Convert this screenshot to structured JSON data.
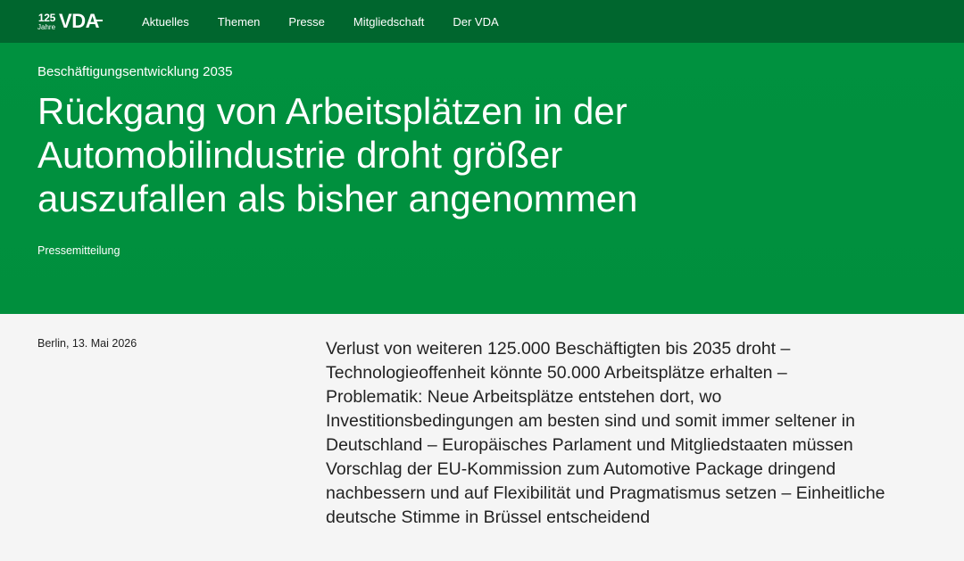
{
  "header": {
    "logo": {
      "anniversary_number": "125",
      "anniversary_word": "Jahre",
      "brand": "VDA"
    },
    "nav": [
      {
        "label": "Aktuelles"
      },
      {
        "label": "Themen"
      },
      {
        "label": "Presse"
      },
      {
        "label": "Mitgliedschaft"
      },
      {
        "label": "Der VDA"
      }
    ]
  },
  "hero": {
    "kicker": "Beschäftigungsentwicklung 2035",
    "headline": "Rückgang von Arbeitsplätzen in der Automobilindustrie droht größer auszufallen als bisher angenommen",
    "category": "Pressemitteilung"
  },
  "article": {
    "dateline": "Berlin, 13. Mai 2026",
    "lead": "Verlust von weiteren 125.000 Beschäftigten bis 2035 droht – Technologieoffenheit könnte 50.000 Arbeitsplätze erhalten – Problematik: Neue Arbeitsplätze entstehen dort, wo Investitionsbedingungen am besten sind und somit immer seltener in Deutschland – Europäisches Parlament und Mitgliedstaaten müssen Vorschlag der EU-Kommission zum Automotive Package dringend nachbessern und auf Flexibilität und Pragmatismus setzen – Einheitliche deutsche Stimme in Brüssel entscheidend"
  },
  "colors": {
    "topbar": "#00662e",
    "hero": "#00913f",
    "body_bg": "#f5f5f5"
  }
}
